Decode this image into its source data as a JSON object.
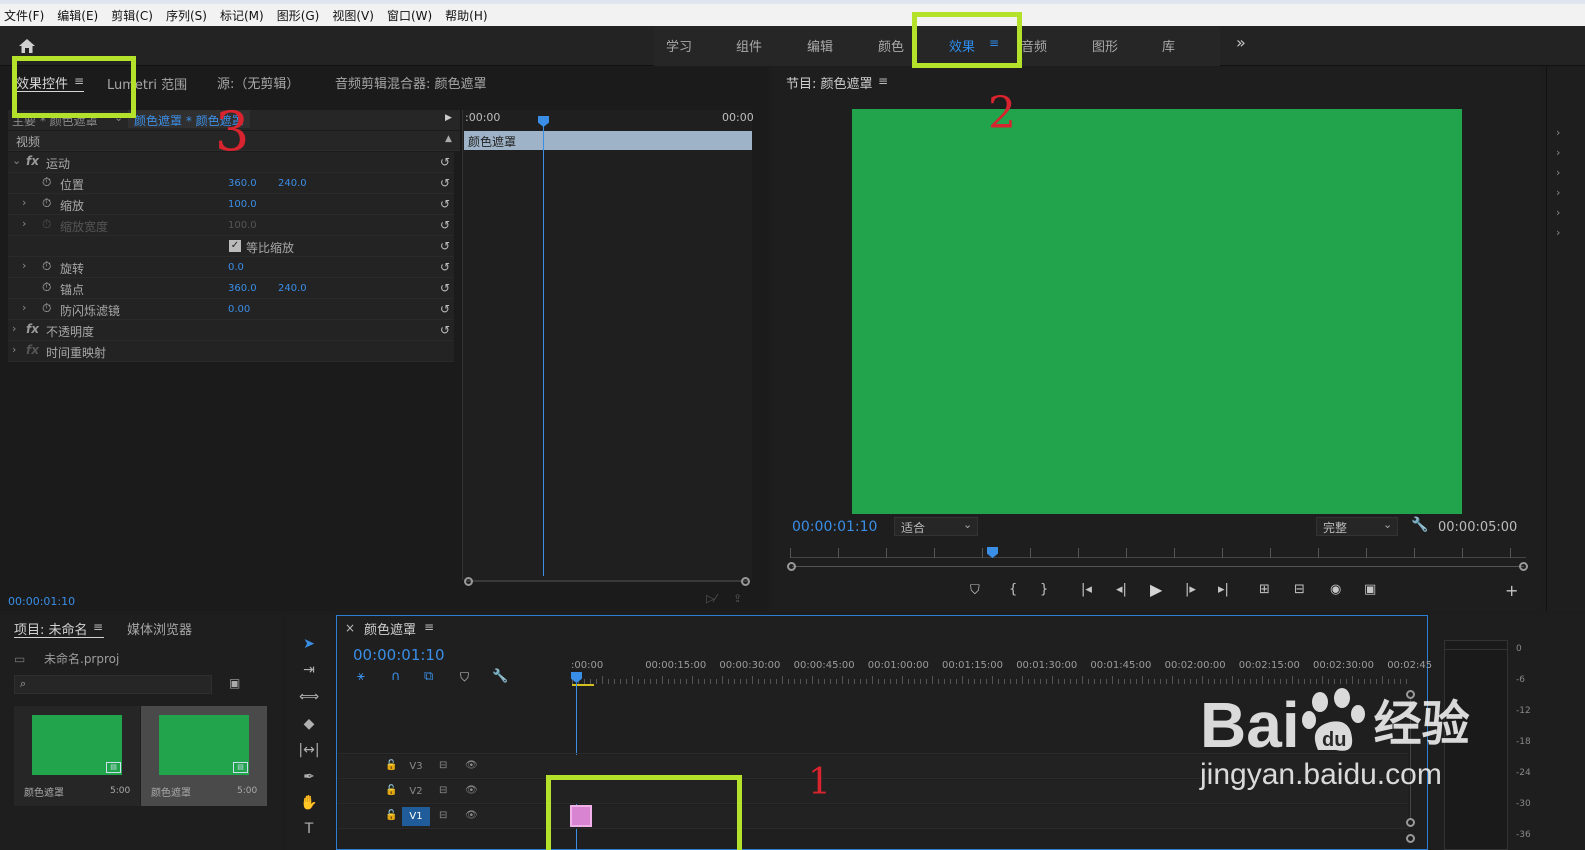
{
  "menu": [
    "文件(F)",
    "编辑(E)",
    "剪辑(C)",
    "序列(S)",
    "标记(M)",
    "图形(G)",
    "视图(V)",
    "窗口(W)",
    "帮助(H)"
  ],
  "workspaces": [
    {
      "label": "学习",
      "active": false
    },
    {
      "label": "组件",
      "active": false
    },
    {
      "label": "编辑",
      "active": false
    },
    {
      "label": "颜色",
      "active": false
    },
    {
      "label": "效果",
      "active": true
    },
    {
      "label": "音频",
      "active": false
    },
    {
      "label": "图形",
      "active": false
    },
    {
      "label": "库",
      "active": false
    }
  ],
  "more_symbol": "»",
  "top_left_tabs": {
    "effect_controls": "效果控件",
    "lumetri": "Lumetri 范围",
    "source": "源:（无剪辑）",
    "audio_mixer": "音频剪辑混合器: 颜色遮罩"
  },
  "effect_controls": {
    "master": "主要 * 颜色遮罩",
    "clip": "颜色遮罩 * 颜色遮罩",
    "video_label": "视频",
    "rows": [
      {
        "label": "运动",
        "v1": "",
        "v2": "",
        "kind": "fx"
      },
      {
        "label": "位置",
        "v1": "360.0",
        "v2": "240.0",
        "kind": "prop"
      },
      {
        "label": "缩放",
        "v1": "100.0",
        "v2": "",
        "kind": "prop"
      },
      {
        "label": "缩放宽度",
        "v1": "100.0",
        "v2": "",
        "kind": "disabled"
      },
      {
        "label": "等比缩放",
        "v1": "",
        "v2": "",
        "kind": "check"
      },
      {
        "label": "旋转",
        "v1": "0.0",
        "v2": "",
        "kind": "prop"
      },
      {
        "label": "锚点",
        "v1": "360.0",
        "v2": "240.0",
        "kind": "prop"
      },
      {
        "label": "防闪烁滤镜",
        "v1": "0.00",
        "v2": "",
        "kind": "prop"
      },
      {
        "label": "不透明度",
        "v1": "",
        "v2": "",
        "kind": "fx"
      },
      {
        "label": "时间重映射",
        "v1": "",
        "v2": "",
        "kind": "fxdim"
      }
    ],
    "mini_start": ":00:00",
    "mini_end": "00:00",
    "clip_bar": "颜色遮罩",
    "timecode": "00:00:01:10"
  },
  "program": {
    "title": "节目: 颜色遮罩",
    "timecode": "00:00:01:10",
    "fit": "适合",
    "quality": "完整",
    "duration": "00:00:05:00",
    "frame_color": "#22a44c"
  },
  "project": {
    "tab": "项目: 未命名",
    "media_browser": "媒体浏览器",
    "file": "未命名.prproj",
    "items": [
      {
        "name": "颜色遮罩",
        "dur": "5:00"
      },
      {
        "name": "颜色遮罩",
        "dur": "5:00"
      }
    ]
  },
  "timeline": {
    "title": "颜色遮罩",
    "timecode": "00:00:01:10",
    "ruler": [
      ":00:00",
      "00:00:15:00",
      "00:00:30:00",
      "00:00:45:00",
      "00:01:00:00",
      "00:01:15:00",
      "00:01:30:00",
      "00:01:45:00",
      "00:02:00:00",
      "00:02:15:00",
      "00:02:30:00",
      "00:02:45:"
    ],
    "tracks": [
      "V3",
      "V2",
      "V1"
    ]
  },
  "audio_meter": [
    "0",
    "-6",
    "-12",
    "-18",
    "-24",
    "-30",
    "-36"
  ],
  "annotations": [
    "1",
    "2",
    "3"
  ],
  "watermark": {
    "brand": "Bai",
    "du": "du",
    "cn": "经验",
    "url": "jingyan.baidu.com"
  }
}
